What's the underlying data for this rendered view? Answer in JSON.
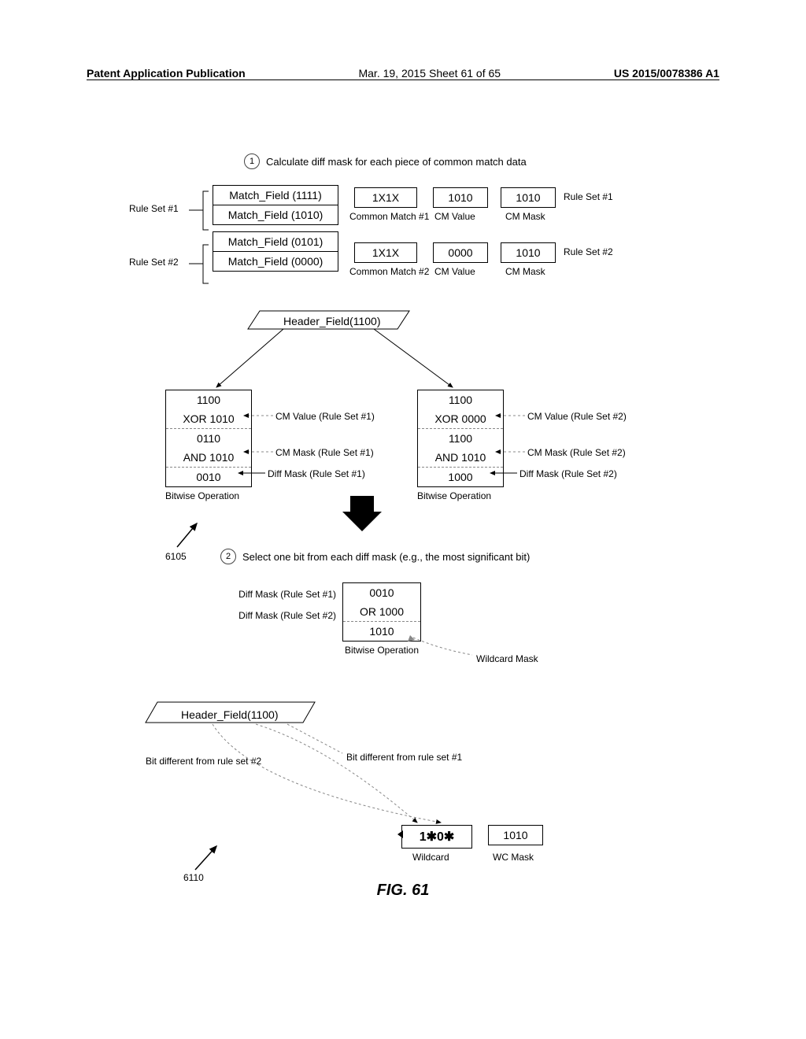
{
  "header": {
    "left": "Patent Application Publication",
    "center": "Mar. 19, 2015  Sheet 61 of 65",
    "right": "US 2015/0078386 A1"
  },
  "step1": {
    "num": "1",
    "text": "Calculate diff mask for each piece of common match data"
  },
  "step2": {
    "num": "2",
    "text": "Select one bit from each diff mask (e.g., the most significant bit)"
  },
  "ruleset1_label": "Rule Set #1",
  "ruleset2_label": "Rule Set #2",
  "match_fields": {
    "rs1a": "Match_Field (1111)",
    "rs1b": "Match_Field (1010)",
    "rs2a": "Match_Field (0101)",
    "rs2b": "Match_Field (0000)"
  },
  "cm1": {
    "cm": "1X1X",
    "val": "1010",
    "mask": "1010",
    "label": "Common Match #1",
    "vlabel": "CM Value",
    "mlabel": "CM Mask",
    "right": "Rule Set #1"
  },
  "cm2": {
    "cm": "1X1X",
    "val": "0000",
    "mask": "1010",
    "label": "Common Match #2",
    "vlabel": "CM Value",
    "mlabel": "CM Mask",
    "right": "Rule Set #2"
  },
  "header_field": "Header_Field(1100)",
  "bitop1": {
    "r1": "1100",
    "r2": "XOR 1010",
    "r3": "0110",
    "r4": "AND 1010",
    "r5": "0010",
    "caption": "Bitwise Operation",
    "a1": "CM Value (Rule Set #1)",
    "a2": "CM Mask (Rule Set #1)",
    "a3": "Diff Mask (Rule Set #1)"
  },
  "bitop2": {
    "r1": "1100",
    "r2": "XOR 0000",
    "r3": "1100",
    "r4": "AND 1010",
    "r5": "1000",
    "caption": "Bitwise Operation",
    "a1": "CM Value (Rule Set #2)",
    "a2": "CM Mask (Rule Set #2)",
    "a3": "Diff Mask (Rule Set #2)"
  },
  "ref6105": "6105",
  "ref6110": "6110",
  "bitop3": {
    "l1": "Diff Mask (Rule Set #1)",
    "l2": "Diff Mask (Rule Set #2)",
    "r1": "0010",
    "r2": "OR 1000",
    "r3": "1010",
    "caption": "Bitwise Operation",
    "res_label": "Wildcard Mask"
  },
  "header_field2": "Header_Field(1100)",
  "bit_diff1": "Bit different from rule set #1",
  "bit_diff2": "Bit different from rule set #2",
  "wildcard": {
    "val": "1✱0✱",
    "mask": "1010",
    "vlabel": "Wildcard",
    "mlabel": "WC Mask"
  },
  "fig": "FIG. 61"
}
